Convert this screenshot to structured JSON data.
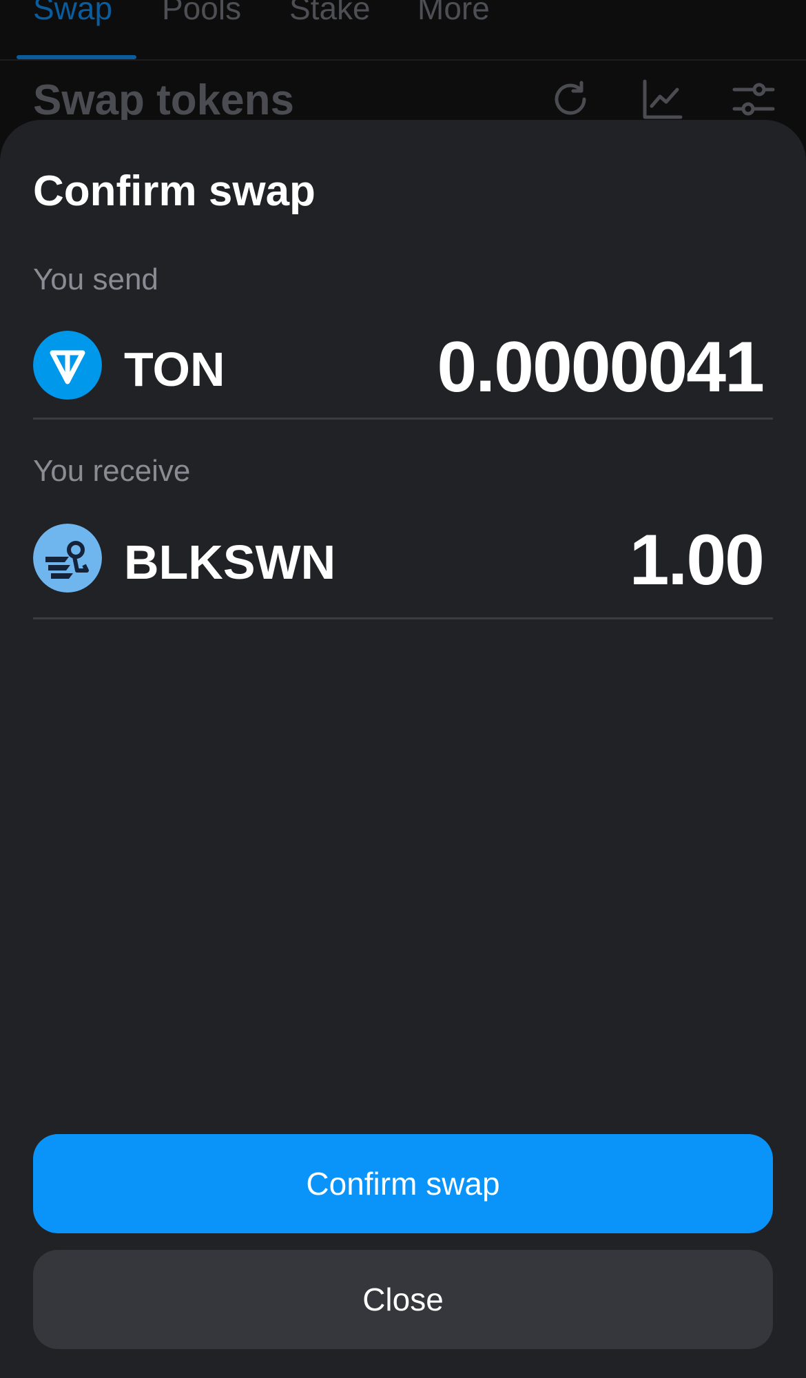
{
  "top_tabs": [
    {
      "label": "Swap",
      "active": true
    },
    {
      "label": "Pools",
      "active": false
    },
    {
      "label": "Stake",
      "active": false
    },
    {
      "label": "More",
      "active": false
    }
  ],
  "background": {
    "title": "Swap tokens",
    "icons": [
      "refresh-icon",
      "chart-icon",
      "settings-sliders-icon"
    ]
  },
  "sheet": {
    "title": "Confirm swap",
    "send": {
      "label": "You send",
      "symbol": "TON",
      "amount": "0.0000041",
      "icon": "ton-token-icon",
      "icon_color": "#0098ea"
    },
    "receive": {
      "label": "You receive",
      "symbol": "BLKSWN",
      "amount": "1.00",
      "icon": "blkswn-token-icon",
      "icon_color": "#6fb5ee"
    },
    "confirm_label": "Confirm swap",
    "close_label": "Close"
  },
  "colors": {
    "accent": "#0a93f9",
    "sheet_bg": "#212226",
    "secondary_button": "#36373c"
  }
}
